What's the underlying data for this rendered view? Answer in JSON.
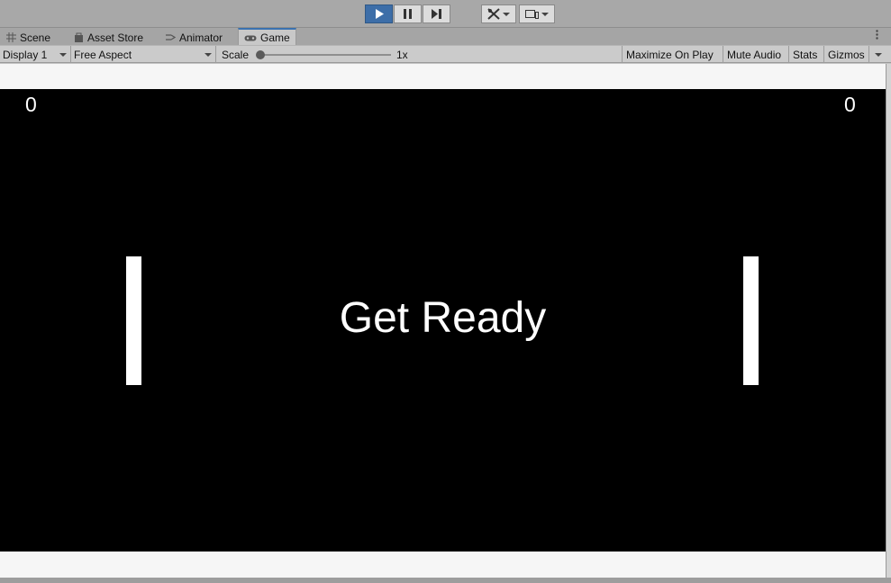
{
  "toolbar": {
    "play_icon": "play-icon",
    "pause_icon": "pause-icon",
    "step_icon": "step-icon",
    "tools_icon": "tools-icon",
    "device_icon": "device-icon",
    "active_color": "#3d6ea8"
  },
  "tabs": [
    {
      "label": "Scene",
      "icon": "grid-icon"
    },
    {
      "label": "Asset Store",
      "icon": "bag-icon"
    },
    {
      "label": "Animator",
      "icon": "animator-icon"
    },
    {
      "label": "Game",
      "icon": "gamepad-icon"
    }
  ],
  "game_toolbar": {
    "display": "Display 1",
    "aspect": "Free Aspect",
    "scale_label": "Scale",
    "scale_value": "1x",
    "maximize": "Maximize On Play",
    "mute": "Mute Audio",
    "stats": "Stats",
    "gizmos": "Gizmos"
  },
  "game": {
    "score_left": "0",
    "score_right": "0",
    "message": "Get Ready"
  }
}
